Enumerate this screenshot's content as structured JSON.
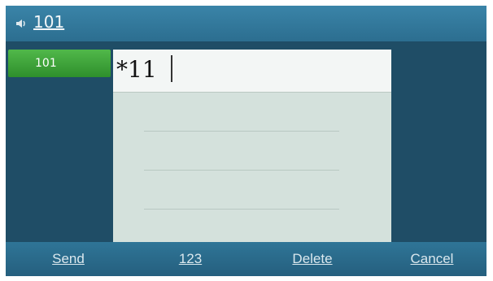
{
  "titlebar": {
    "title": "101",
    "icon": "speaker-icon"
  },
  "account": {
    "label": "101"
  },
  "dialog": {
    "input_value": "*11"
  },
  "softkeys": {
    "send": "Send",
    "mode": "123",
    "delete": "Delete",
    "cancel": "Cancel"
  }
}
